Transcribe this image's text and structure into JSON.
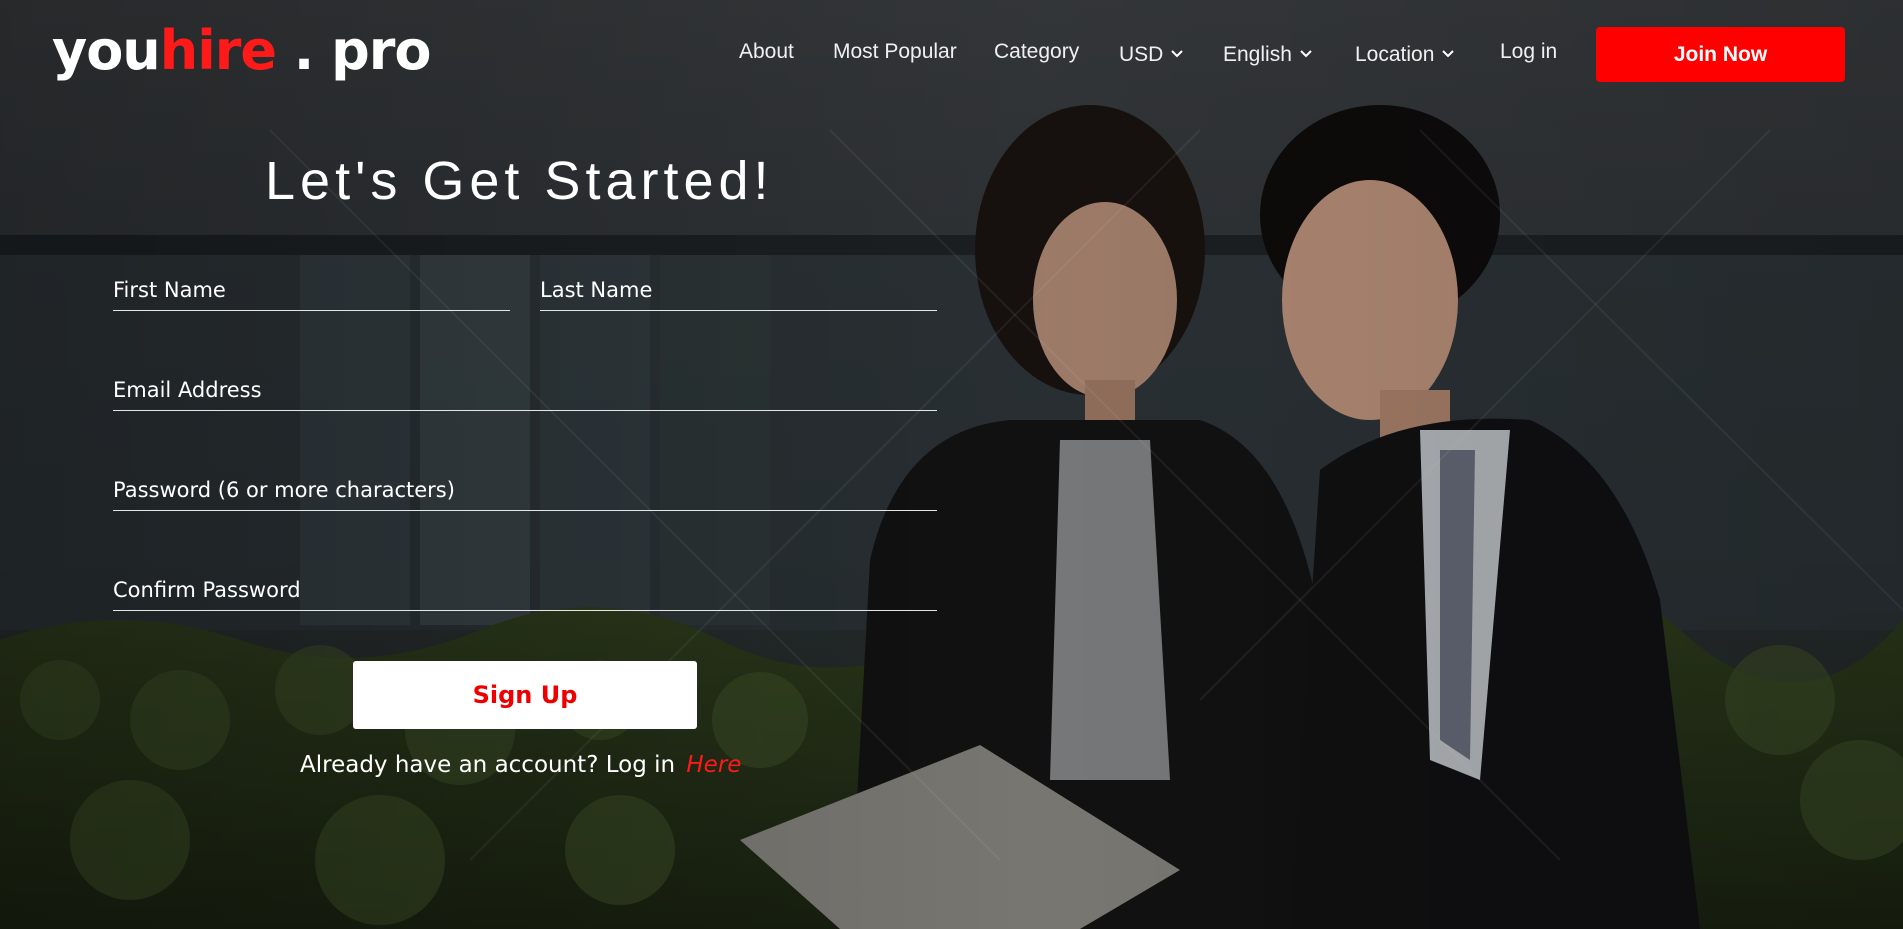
{
  "brand": {
    "part1": "you",
    "part2": "hire",
    "part3": " . pro"
  },
  "nav": {
    "about": "About",
    "most_popular": "Most Popular",
    "category": "Category",
    "currency": "USD",
    "language": "English",
    "location": "Location",
    "login": "Log in",
    "join": "Join Now"
  },
  "form": {
    "title": "Let's Get Started!",
    "first_name": "First Name",
    "last_name": "Last Name",
    "email": "Email Address",
    "password": "Password (6 or more characters)",
    "confirm_password": "Confirm Password",
    "submit": "Sign Up",
    "login_prompt": "Already have an account? Log in",
    "login_link": "Here"
  },
  "colors": {
    "accent": "#ff0000",
    "text": "#ffffff"
  },
  "icons": [
    "chevron-down-icon"
  ]
}
